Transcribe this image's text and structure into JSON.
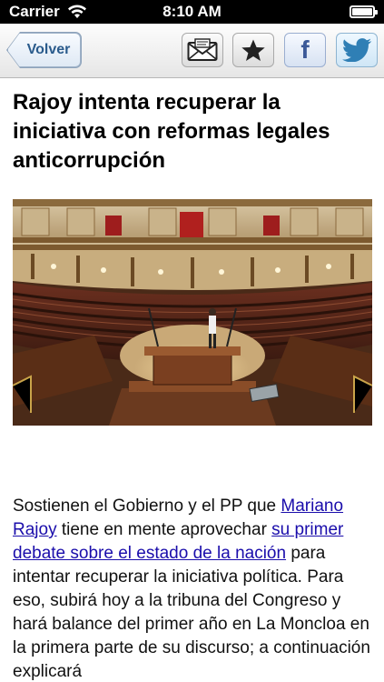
{
  "status_bar": {
    "carrier": "Carrier",
    "time": "8:10 AM",
    "battery_level": 1.0
  },
  "nav": {
    "back_label": "Volver",
    "buttons": [
      {
        "icon": "envelope-icon"
      },
      {
        "icon": "star-icon"
      },
      {
        "icon": "facebook-icon",
        "glyph": "f"
      },
      {
        "icon": "twitter-icon"
      }
    ]
  },
  "article": {
    "headline": "Rajoy intenta recuperar la iniciativa con reformas legales anticorrupción",
    "body": {
      "t1": "Sostienen el Gobierno y el PP que ",
      "link1": "Mariano Rajoy",
      "t2": " tiene en mente aprovechar ",
      "link2": "su primer debate sobre el estado de la nación",
      "t3": " para intentar recuperar la iniciativa política. Para eso, subirá hoy a la tribuna del Congreso y hará balance del primer año en La Moncloa en la primera parte de su discurso; a continuación explicará"
    }
  },
  "colors": {
    "status_bar_bg": "#000000",
    "nav_back_text": "#2a5b8c",
    "facebook": "#3b5998",
    "twitter": "#2f7fb5",
    "link": "#1a0dab"
  }
}
